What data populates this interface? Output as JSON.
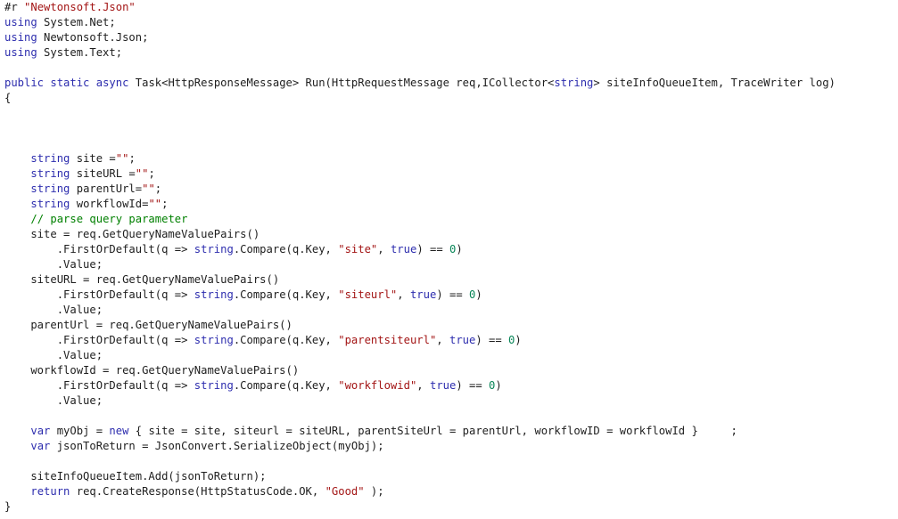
{
  "editor": {
    "language": "csharp",
    "lines": [
      [
        [
          "pp",
          "#r "
        ],
        [
          "str",
          "\"Newtonsoft.Json\""
        ]
      ],
      [
        [
          "kw",
          "using"
        ],
        [
          "t",
          " System.Net;"
        ]
      ],
      [
        [
          "kw",
          "using"
        ],
        [
          "t",
          " Newtonsoft.Json;"
        ]
      ],
      [
        [
          "kw",
          "using"
        ],
        [
          "t",
          " System.Text;"
        ]
      ],
      [],
      [
        [
          "kw",
          "public"
        ],
        [
          "t",
          " "
        ],
        [
          "kw",
          "static"
        ],
        [
          "t",
          " "
        ],
        [
          "kw",
          "async"
        ],
        [
          "t",
          " Task<HttpResponseMessage> Run(HttpRequestMessage req,ICollector<"
        ],
        [
          "kw",
          "string"
        ],
        [
          "t",
          "> siteInfoQueueItem, TraceWriter log)"
        ]
      ],
      [
        [
          "t",
          "{"
        ]
      ],
      [],
      [],
      [],
      [
        [
          "t",
          "    "
        ],
        [
          "kw",
          "string"
        ],
        [
          "t",
          " site ="
        ],
        [
          "str",
          "\"\""
        ],
        [
          "t",
          ";"
        ]
      ],
      [
        [
          "t",
          "    "
        ],
        [
          "kw",
          "string"
        ],
        [
          "t",
          " siteURL ="
        ],
        [
          "str",
          "\"\""
        ],
        [
          "t",
          ";"
        ]
      ],
      [
        [
          "t",
          "    "
        ],
        [
          "kw",
          "string"
        ],
        [
          "t",
          " parentUrl="
        ],
        [
          "str",
          "\"\""
        ],
        [
          "t",
          ";"
        ]
      ],
      [
        [
          "t",
          "    "
        ],
        [
          "kw",
          "string"
        ],
        [
          "t",
          " workflowId="
        ],
        [
          "str",
          "\"\""
        ],
        [
          "t",
          ";"
        ]
      ],
      [
        [
          "t",
          "    "
        ],
        [
          "cm",
          "// parse query parameter"
        ]
      ],
      [
        [
          "t",
          "    site = req.GetQueryNameValuePairs()"
        ]
      ],
      [
        [
          "t",
          "        .FirstOrDefault(q => "
        ],
        [
          "kw",
          "string"
        ],
        [
          "t",
          ".Compare(q.Key, "
        ],
        [
          "str",
          "\"site\""
        ],
        [
          "t",
          ", "
        ],
        [
          "kw",
          "true"
        ],
        [
          "t",
          ") == "
        ],
        [
          "num",
          "0"
        ],
        [
          "t",
          ")"
        ]
      ],
      [
        [
          "t",
          "        .Value;"
        ]
      ],
      [
        [
          "t",
          "    siteURL = req.GetQueryNameValuePairs()"
        ]
      ],
      [
        [
          "t",
          "        .FirstOrDefault(q => "
        ],
        [
          "kw",
          "string"
        ],
        [
          "t",
          ".Compare(q.Key, "
        ],
        [
          "str",
          "\"siteurl\""
        ],
        [
          "t",
          ", "
        ],
        [
          "kw",
          "true"
        ],
        [
          "t",
          ") == "
        ],
        [
          "num",
          "0"
        ],
        [
          "t",
          ")"
        ]
      ],
      [
        [
          "t",
          "        .Value;"
        ]
      ],
      [
        [
          "t",
          "    parentUrl = req.GetQueryNameValuePairs()"
        ]
      ],
      [
        [
          "t",
          "        .FirstOrDefault(q => "
        ],
        [
          "kw",
          "string"
        ],
        [
          "t",
          ".Compare(q.Key, "
        ],
        [
          "str",
          "\"parentsiteurl\""
        ],
        [
          "t",
          ", "
        ],
        [
          "kw",
          "true"
        ],
        [
          "t",
          ") == "
        ],
        [
          "num",
          "0"
        ],
        [
          "t",
          ")"
        ]
      ],
      [
        [
          "t",
          "        .Value;"
        ]
      ],
      [
        [
          "t",
          "    workflowId = req.GetQueryNameValuePairs()"
        ]
      ],
      [
        [
          "t",
          "        .FirstOrDefault(q => "
        ],
        [
          "kw",
          "string"
        ],
        [
          "t",
          ".Compare(q.Key, "
        ],
        [
          "str",
          "\"workflowid\""
        ],
        [
          "t",
          ", "
        ],
        [
          "kw",
          "true"
        ],
        [
          "t",
          ") == "
        ],
        [
          "num",
          "0"
        ],
        [
          "t",
          ")"
        ]
      ],
      [
        [
          "t",
          "        .Value;"
        ]
      ],
      [],
      [
        [
          "t",
          "    "
        ],
        [
          "kw",
          "var"
        ],
        [
          "t",
          " myObj = "
        ],
        [
          "kw",
          "new"
        ],
        [
          "t",
          " { site = site, siteurl = siteURL, parentSiteUrl = parentUrl, workflowID = workflowId }     ;"
        ]
      ],
      [
        [
          "t",
          "    "
        ],
        [
          "kw",
          "var"
        ],
        [
          "t",
          " jsonToReturn = JsonConvert.SerializeObject(myObj);"
        ]
      ],
      [],
      [
        [
          "t",
          "    siteInfoQueueItem.Add(jsonToReturn);"
        ]
      ],
      [
        [
          "t",
          "    "
        ],
        [
          "kw",
          "return"
        ],
        [
          "t",
          " req.CreateResponse(HttpStatusCode.OK, "
        ],
        [
          "str",
          "\"Good\""
        ],
        [
          "t",
          " );"
        ]
      ],
      [
        [
          "t",
          "}"
        ]
      ]
    ]
  }
}
